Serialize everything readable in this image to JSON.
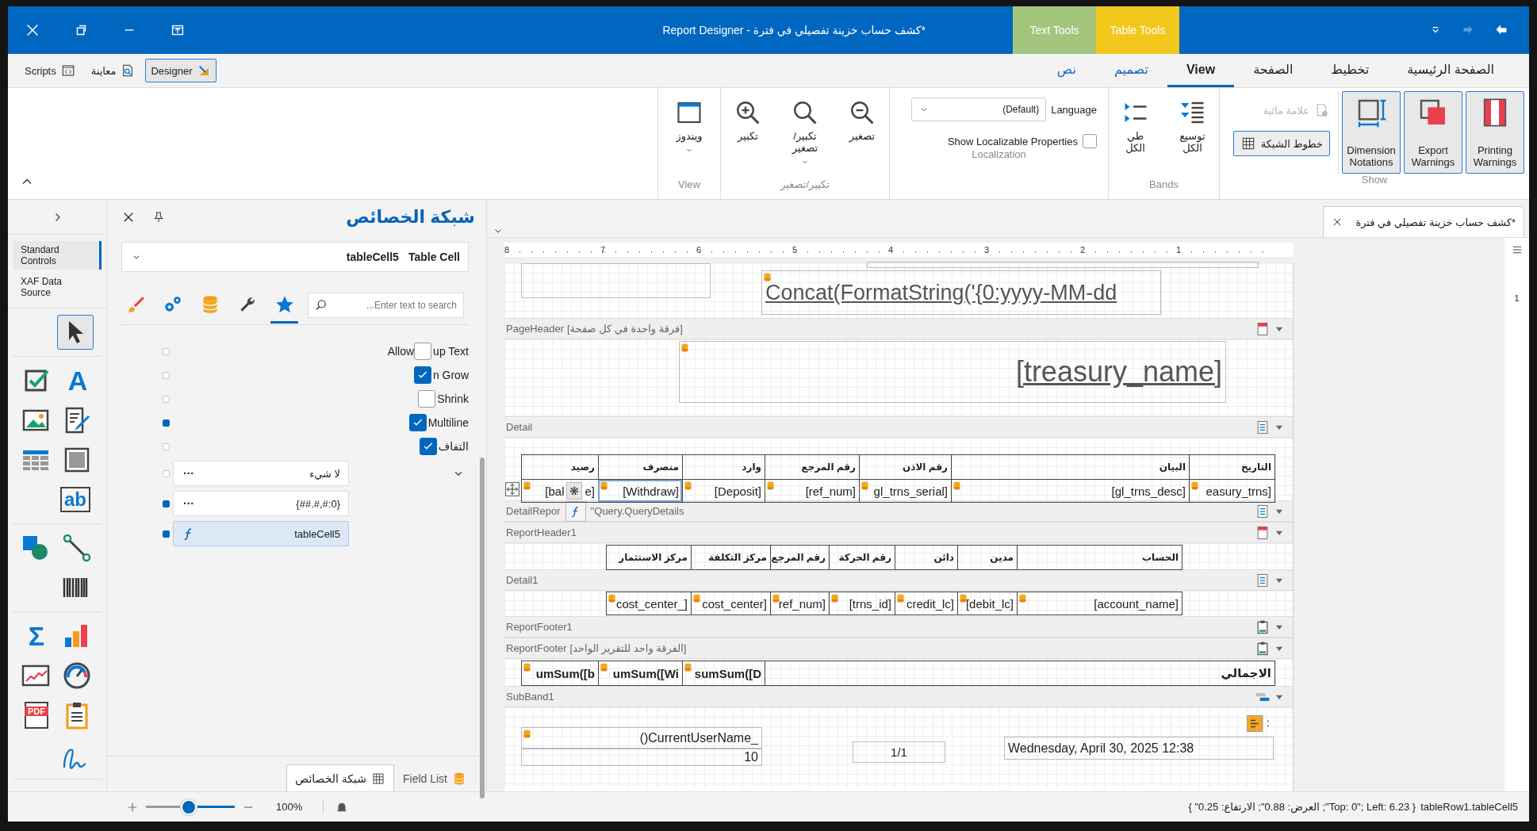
{
  "title_bar": {
    "title": "Report Designer - كشف حساب خزينة تفصيلي في فترة*",
    "context_tabs": [
      {
        "label": "Table Tools",
        "color": "#f2c81d"
      },
      {
        "label": "Text Tools",
        "color": "#a3c57c"
      }
    ]
  },
  "view_switch": [
    {
      "label": "Designer",
      "kind": "designer",
      "selected": true
    },
    {
      "label": "معاينة",
      "kind": "preview",
      "selected": false
    },
    {
      "label": "Scripts",
      "kind": "scripts",
      "selected": false
    }
  ],
  "ribbon_tabs": [
    {
      "label": "الصفحة الرئيسية",
      "kind": "normal",
      "selected": false
    },
    {
      "label": "تخطيط",
      "kind": "normal",
      "selected": false
    },
    {
      "label": "الصفحة",
      "kind": "normal",
      "selected": false
    },
    {
      "label": "View",
      "kind": "normal",
      "selected": true
    },
    {
      "label": "تصميم",
      "kind": "contextual",
      "selected": false
    },
    {
      "label": "نص",
      "kind": "contextual",
      "selected": false
    }
  ],
  "ribbon_groups": [
    {
      "kind": "show",
      "label": "Show",
      "toggles": [
        {
          "label": "Printing Warnings",
          "kind": "printing",
          "on": true
        },
        {
          "label": "Export Warnings",
          "kind": "export",
          "on": true
        },
        {
          "label": "Dimension Notations",
          "kind": "dimension",
          "on": true
        }
      ],
      "watermark": {
        "label": "علامة مائية",
        "disabled": true
      },
      "gridlines": {
        "label": "خطوط الشبكة"
      }
    },
    {
      "kind": "buttons",
      "label": "Bands",
      "items": [
        {
          "label": "توسيع الكل",
          "kind": "expand",
          "dropdown": false
        },
        {
          "label": "طي الكل",
          "kind": "collapse",
          "dropdown": false
        }
      ]
    },
    {
      "kind": "localization",
      "label": "Localization",
      "language_label": "Language",
      "language_value": "(Default)",
      "checkbox_label": "Show Localizable Properties",
      "checked": false
    },
    {
      "kind": "buttons",
      "label": "تكبير/تصغير",
      "items": [
        {
          "label": "تصغير",
          "kind": "zoom_out",
          "dropdown": false
        },
        {
          "label": "تكبير/تصغير",
          "kind": "zoom",
          "dropdown": true
        },
        {
          "label": "تكبير",
          "kind": "zoom_in",
          "dropdown": false
        }
      ]
    },
    {
      "kind": "buttons",
      "label": "View",
      "items": [
        {
          "label": "ويندوز",
          "kind": "window",
          "dropdown": true
        }
      ]
    }
  ],
  "toolbox": {
    "categories": [
      {
        "label": "Standard Controls",
        "selected": true
      },
      {
        "label": "XAF Data Source",
        "selected": false
      }
    ],
    "groups": [
      [
        [
          {
            "kind": "pointer",
            "selected": true
          }
        ]
      ],
      [
        [
          {
            "kind": "label",
            "glyph": "A",
            "selected": false
          },
          {
            "kind": "checkbox",
            "selected": false
          }
        ],
        [
          {
            "kind": "richtext",
            "selected": false
          },
          {
            "kind": "picture",
            "selected": false
          }
        ],
        [
          {
            "kind": "panel",
            "selected": false
          },
          {
            "kind": "table",
            "selected": false
          }
        ],
        [
          {
            "kind": "textbox",
            "glyph": "ab",
            "selected": false
          }
        ]
      ],
      [
        [
          {
            "kind": "line",
            "selected": false
          },
          {
            "kind": "shape",
            "selected": false
          }
        ],
        [
          {
            "kind": "barcode",
            "selected": false
          }
        ]
      ],
      [
        [
          {
            "kind": "chart",
            "selected": false
          },
          {
            "kind": "sum",
            "glyph": "Σ",
            "selected": false
          }
        ],
        [
          {
            "kind": "gauge",
            "selected": false
          },
          {
            "kind": "sparkline",
            "selected": false
          }
        ],
        [
          {
            "kind": "clipboard",
            "selected": false
          },
          {
            "kind": "pdf",
            "glyph": "PDF",
            "selected": false
          }
        ],
        [
          {
            "kind": "signature",
            "selected": false
          }
        ]
      ]
    ]
  },
  "property_grid": {
    "title": "شبكة الخصائص",
    "object_name": "tableCell5",
    "object_type": "Table Cell",
    "search_placeholder": "Enter text to search...",
    "tabs": [
      {
        "kind": "star",
        "selected": true
      },
      {
        "kind": "wrench",
        "selected": false
      },
      {
        "kind": "database",
        "selected": false
      },
      {
        "kind": "gears",
        "selected": false
      },
      {
        "kind": "brush",
        "selected": false
      }
    ],
    "rows": [
      {
        "kind": "checkbox",
        "label_before": "Allow",
        "label": "up Text",
        "checked": false,
        "modified": false
      },
      {
        "kind": "checkbox",
        "label": "n Grow",
        "checked": true,
        "modified": false
      },
      {
        "kind": "checkbox",
        "label": "Shrink",
        "checked": false,
        "modified": false
      },
      {
        "kind": "checkbox",
        "label": "Multiline",
        "checked": true,
        "modified": true
      },
      {
        "kind": "checkbox",
        "label": "التفاف",
        "checked": true,
        "modified": false
      },
      {
        "kind": "editor",
        "value": "لا شيء",
        "button": "···",
        "expandable": true,
        "modified": false,
        "selected": false
      },
      {
        "kind": "editor",
        "value": "{##.#,#:0}",
        "button": "···",
        "expandable": false,
        "modified": true,
        "selected": false
      },
      {
        "kind": "expression",
        "value": "tableCell5",
        "modified": true,
        "selected": true
      }
    ],
    "bottom_tabs": [
      {
        "label": "Field List",
        "kind": "fields",
        "selected": false
      },
      {
        "label": "شبكة الخصائص",
        "kind": "properties",
        "selected": true
      }
    ]
  },
  "designer": {
    "document_tab": {
      "title": "كشف حساب خزينة تفصيلي في فترة*",
      "selected": true
    },
    "ruler": [
      "1",
      "2",
      "3",
      "4",
      "5",
      "6",
      "7",
      "8"
    ],
    "vertical_ruler": [
      "1"
    ],
    "bands": [
      {
        "kind": "top",
        "items": [
          {
            "kind": "box"
          },
          {
            "kind": "box"
          },
          {
            "kind": "label",
            "text": "Concat(FormatString('{0:yyyy-MM-dd",
            "bound": true
          }
        ]
      },
      {
        "kind": "page_header",
        "name": "PageHeader",
        "caption": "[فرقة واحدة في كل صفحة]",
        "expanded": true,
        "items": [
          {
            "kind": "label",
            "text": "[treasury_name]",
            "bound": true
          }
        ]
      },
      {
        "kind": "detail",
        "name": "Detail",
        "expanded": true,
        "items": [
          {
            "kind": "table",
            "rows": [
              {
                "kind": "header",
                "cells": [
                  {
                    "text": "التاريخ"
                  },
                  {
                    "text": "البيان"
                  },
                  {
                    "text": "رقم الاذن"
                  },
                  {
                    "text": "رقم المرجع"
                  },
                  {
                    "text": "وارد"
                  },
                  {
                    "text": "منصرف"
                  },
                  {
                    "text": "رصيد"
                  }
                ]
              },
              {
                "kind": "data",
                "cells": [
                  {
                    "text": "easury_trns]",
                    "selected": false
                  },
                  {
                    "text": "[gl_trns_desc]",
                    "selected": false
                  },
                  {
                    "text": "gl_trns_serial]",
                    "selected": false
                  },
                  {
                    "text": "[ref_num]",
                    "selected": false
                  },
                  {
                    "text": "[Deposit]",
                    "selected": false
                  },
                  {
                    "text": "[Withdraw]",
                    "selected": true
                  },
                  {
                    "text": "[bal",
                    "text_end": "e]",
                    "selected": false
                  }
                ]
              }
            ]
          }
        ]
      },
      {
        "kind": "detail_report",
        "name": "DetailRepor",
        "caption": "Query.QueryDetails\"",
        "expanded": true
      },
      {
        "kind": "page_header",
        "name": "ReportHeader1",
        "expanded": true,
        "items": [
          {
            "kind": "table",
            "rows": [
              {
                "kind": "header",
                "cells": [
                  {
                    "text": "الحساب"
                  },
                  {
                    "text": "مدين"
                  },
                  {
                    "text": "دائن"
                  },
                  {
                    "text": "رقم الحركة"
                  },
                  {
                    "text": "رقم المرجع"
                  },
                  {
                    "text": "مركز التكلفة"
                  },
                  {
                    "text": "مركز الاستثمار"
                  }
                ]
              }
            ]
          }
        ]
      },
      {
        "kind": "detail",
        "name": "Detail1",
        "expanded": true,
        "items": [
          {
            "kind": "table",
            "rows": [
              {
                "kind": "data",
                "cells": [
                  {
                    "text": "[account_name]"
                  },
                  {
                    "text": "[debit_lc]"
                  },
                  {
                    "text": "credit_lc]"
                  },
                  {
                    "text": "[trns_id]"
                  },
                  {
                    "text": "ref_num]"
                  },
                  {
                    "text": "cost_center]"
                  },
                  {
                    "text": "cost_center_]"
                  }
                ]
              }
            ]
          }
        ]
      },
      {
        "kind": "footer",
        "name": "ReportFooter1",
        "expanded": true
      },
      {
        "kind": "footer",
        "name": "ReportFooter",
        "caption": "[الفرقة واحد للتقرير الواحد]",
        "expanded": true,
        "items": [
          {
            "kind": "table",
            "rows": [
              {
                "kind": "total",
                "cells": [
                  {
                    "text": "الاجمالي",
                    "bound": false
                  },
                  {
                    "text": "sumSum([D",
                    "bound": true
                  },
                  {
                    "text": "umSum([Wi",
                    "bound": true
                  },
                  {
                    "text": "umSum([b",
                    "bound": true
                  }
                ]
              }
            ]
          }
        ]
      },
      {
        "kind": "subband",
        "name": "SubBand1",
        "expanded": true,
        "items": [
          {
            "kind": "tag"
          },
          {
            "kind": "label",
            "text": "Wednesday, April 30, 2025 12:38",
            "bound": false
          },
          {
            "kind": "label",
            "text": "1/1",
            "bound": false
          },
          {
            "kind": "label",
            "text": "()CurrentUserName_",
            "bound": true
          },
          {
            "kind": "label",
            "text": "10",
            "bound": false
          }
        ]
      }
    ]
  },
  "status_bar": {
    "zoom": {
      "reading": "100%",
      "level": 0.48
    },
    "geometry": "{ Top: 0\"; Left: 6.23\"; العرض: 0.88\"; الارتفاع: 0.25\" }",
    "selection": "tableRow1.tableCell5"
  }
}
